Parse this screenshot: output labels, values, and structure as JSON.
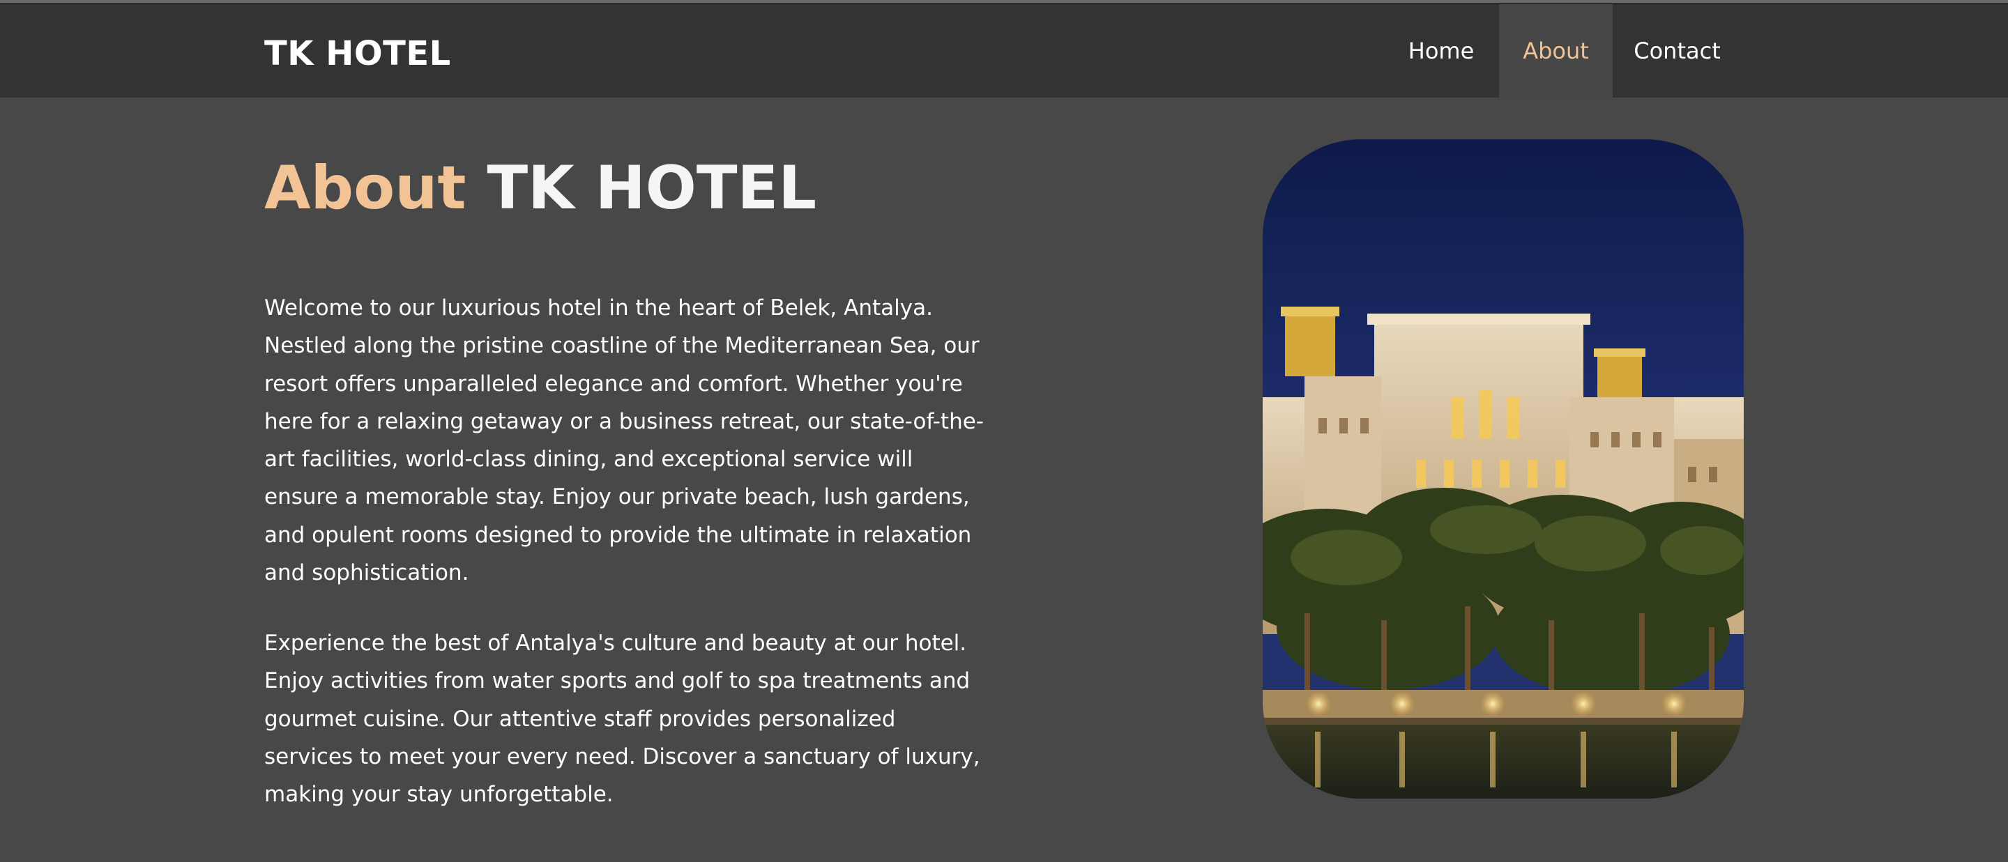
{
  "header": {
    "brand": "TK HOTEL",
    "nav": [
      {
        "label": "Home",
        "active": false
      },
      {
        "label": "About",
        "active": true
      },
      {
        "label": "Contact",
        "active": false
      }
    ]
  },
  "main": {
    "title_accent": "About",
    "title_rest": "TK HOTEL",
    "paragraphs": [
      "Welcome to our luxurious hotel in the heart of Belek, Antalya. Nestled along the pristine coastline of the Mediterranean Sea, our resort offers unparalleled elegance and comfort. Whether you're here for a relaxing getaway or a business retreat, our state-of-the-art facilities, world-class dining, and exceptional service will ensure a memorable stay. Enjoy our private beach, lush gardens, and opulent rooms designed to provide the ultimate in relaxation and sophistication.",
      "Experience the best of Antalya's culture and beauty at our hotel. Enjoy activities from water sports and golf to spa treatments and gourmet cuisine. Our attentive staff provides personalized services to meet your every need. Discover a sanctuary of luxury, making your stay unforgettable."
    ]
  },
  "colors": {
    "background": "#484848",
    "navbar": "#333333",
    "accent": "#f2c394",
    "text": "#ffffff"
  }
}
